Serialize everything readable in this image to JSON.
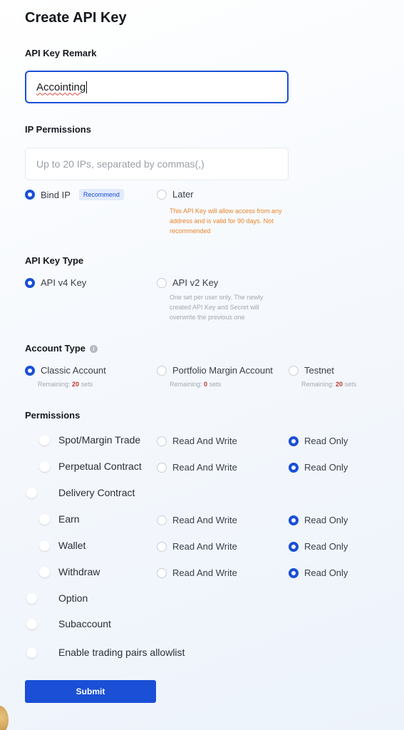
{
  "page": {
    "title": "Create API Key"
  },
  "remark": {
    "label": "API Key Remark",
    "value": "Accointing"
  },
  "ip": {
    "label": "IP Permissions",
    "placeholder": "Up to 20 IPs, separated by commas(,)",
    "options": [
      {
        "label": "Bind IP",
        "badge": "Recommend",
        "selected": true
      },
      {
        "label": "Later",
        "selected": false,
        "note": "This API Key will allow access from any address and is valid for 90 days. Not recommended"
      }
    ]
  },
  "key_type": {
    "label": "API Key Type",
    "options": [
      {
        "label": "API v4 Key",
        "selected": true
      },
      {
        "label": "API v2 Key",
        "selected": false,
        "note": "One set per user only. The newly created API Key and Secret will overwrite the previous one"
      }
    ]
  },
  "account_type": {
    "label": "Account Type",
    "remaining_prefix": "Remaining:",
    "remaining_suffix": "sets",
    "options": [
      {
        "label": "Classic Account",
        "selected": true,
        "remaining": "20"
      },
      {
        "label": "Portfolio Margin Account",
        "selected": false,
        "remaining": "0"
      },
      {
        "label": "Testnet",
        "selected": false,
        "remaining": "20"
      }
    ]
  },
  "permissions": {
    "label": "Permissions",
    "read_write_label": "Read And Write",
    "read_only_label": "Read Only",
    "items": [
      {
        "label": "Spot/Margin Trade",
        "enabled": true,
        "mode": "read_only"
      },
      {
        "label": "Perpetual Contract",
        "enabled": true,
        "mode": "read_only"
      },
      {
        "label": "Delivery Contract",
        "enabled": false
      },
      {
        "label": "Earn",
        "enabled": true,
        "mode": "read_only"
      },
      {
        "label": "Wallet",
        "enabled": true,
        "mode": "read_only"
      },
      {
        "label": "Withdraw",
        "enabled": true,
        "mode": "read_only"
      },
      {
        "label": "Option",
        "enabled": false
      },
      {
        "label": "Subaccount",
        "enabled": false
      },
      {
        "label": "Enable trading pairs allowlist",
        "enabled": false
      }
    ]
  },
  "submit": {
    "label": "Submit"
  },
  "colors": {
    "accent": "#1a4fd6",
    "warning": "#e8842a",
    "badge_bg": "#e3ebfb"
  }
}
